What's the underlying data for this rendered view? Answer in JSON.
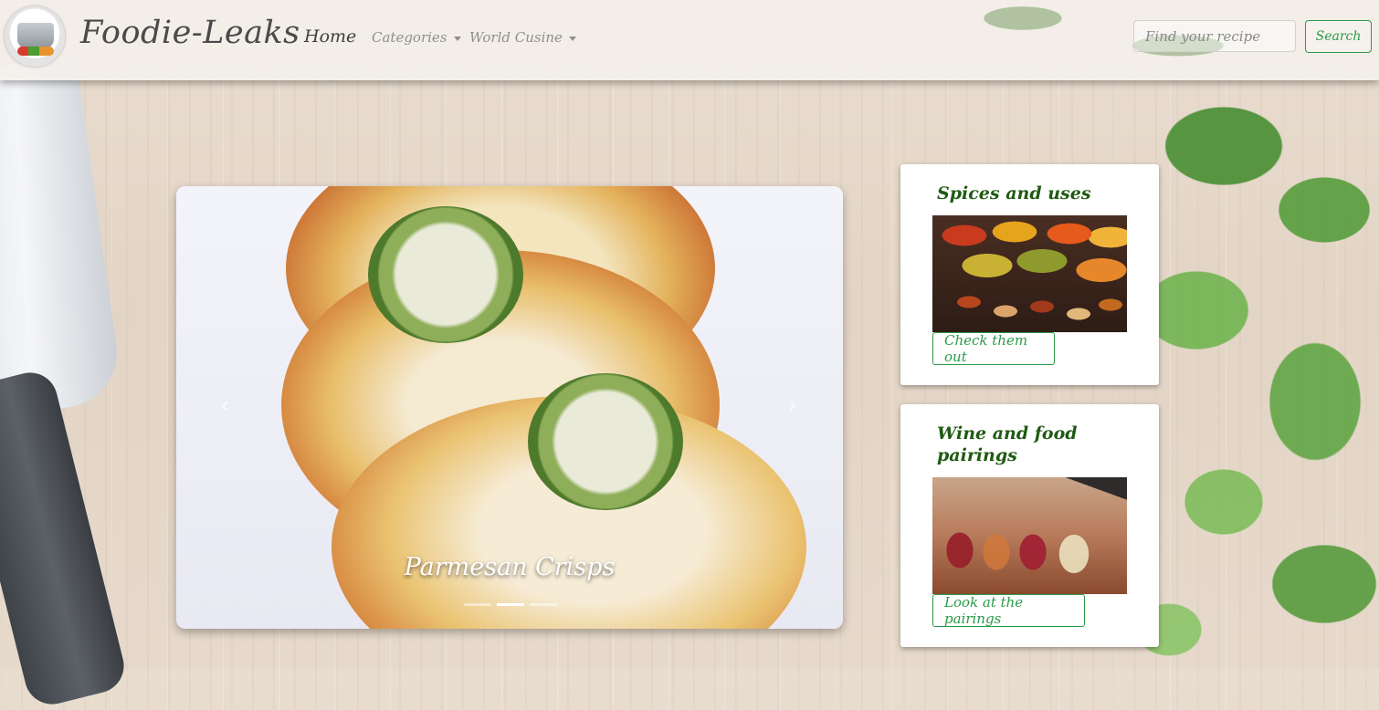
{
  "navbar": {
    "brand": "Foodie-Leaks",
    "home": "Home",
    "categories": "Categories",
    "world_cuisine": "World Cusine",
    "search_placeholder": "Find your recipe",
    "search_button": "Search"
  },
  "carousel": {
    "caption": "Parmesan Crisps",
    "prev_icon": "chevron-left-icon",
    "next_icon": "chevron-right-icon",
    "slides": 3,
    "active_slide": 2
  },
  "cards": [
    {
      "title": "Spices and uses",
      "button": "Check them out"
    },
    {
      "title": "Wine and food pairings",
      "button": "Look at the pairings"
    }
  ],
  "colors": {
    "accent_green": "#2a9a48",
    "card_title_green": "#1f5a12",
    "navbar_text": "#4a4a4a"
  }
}
